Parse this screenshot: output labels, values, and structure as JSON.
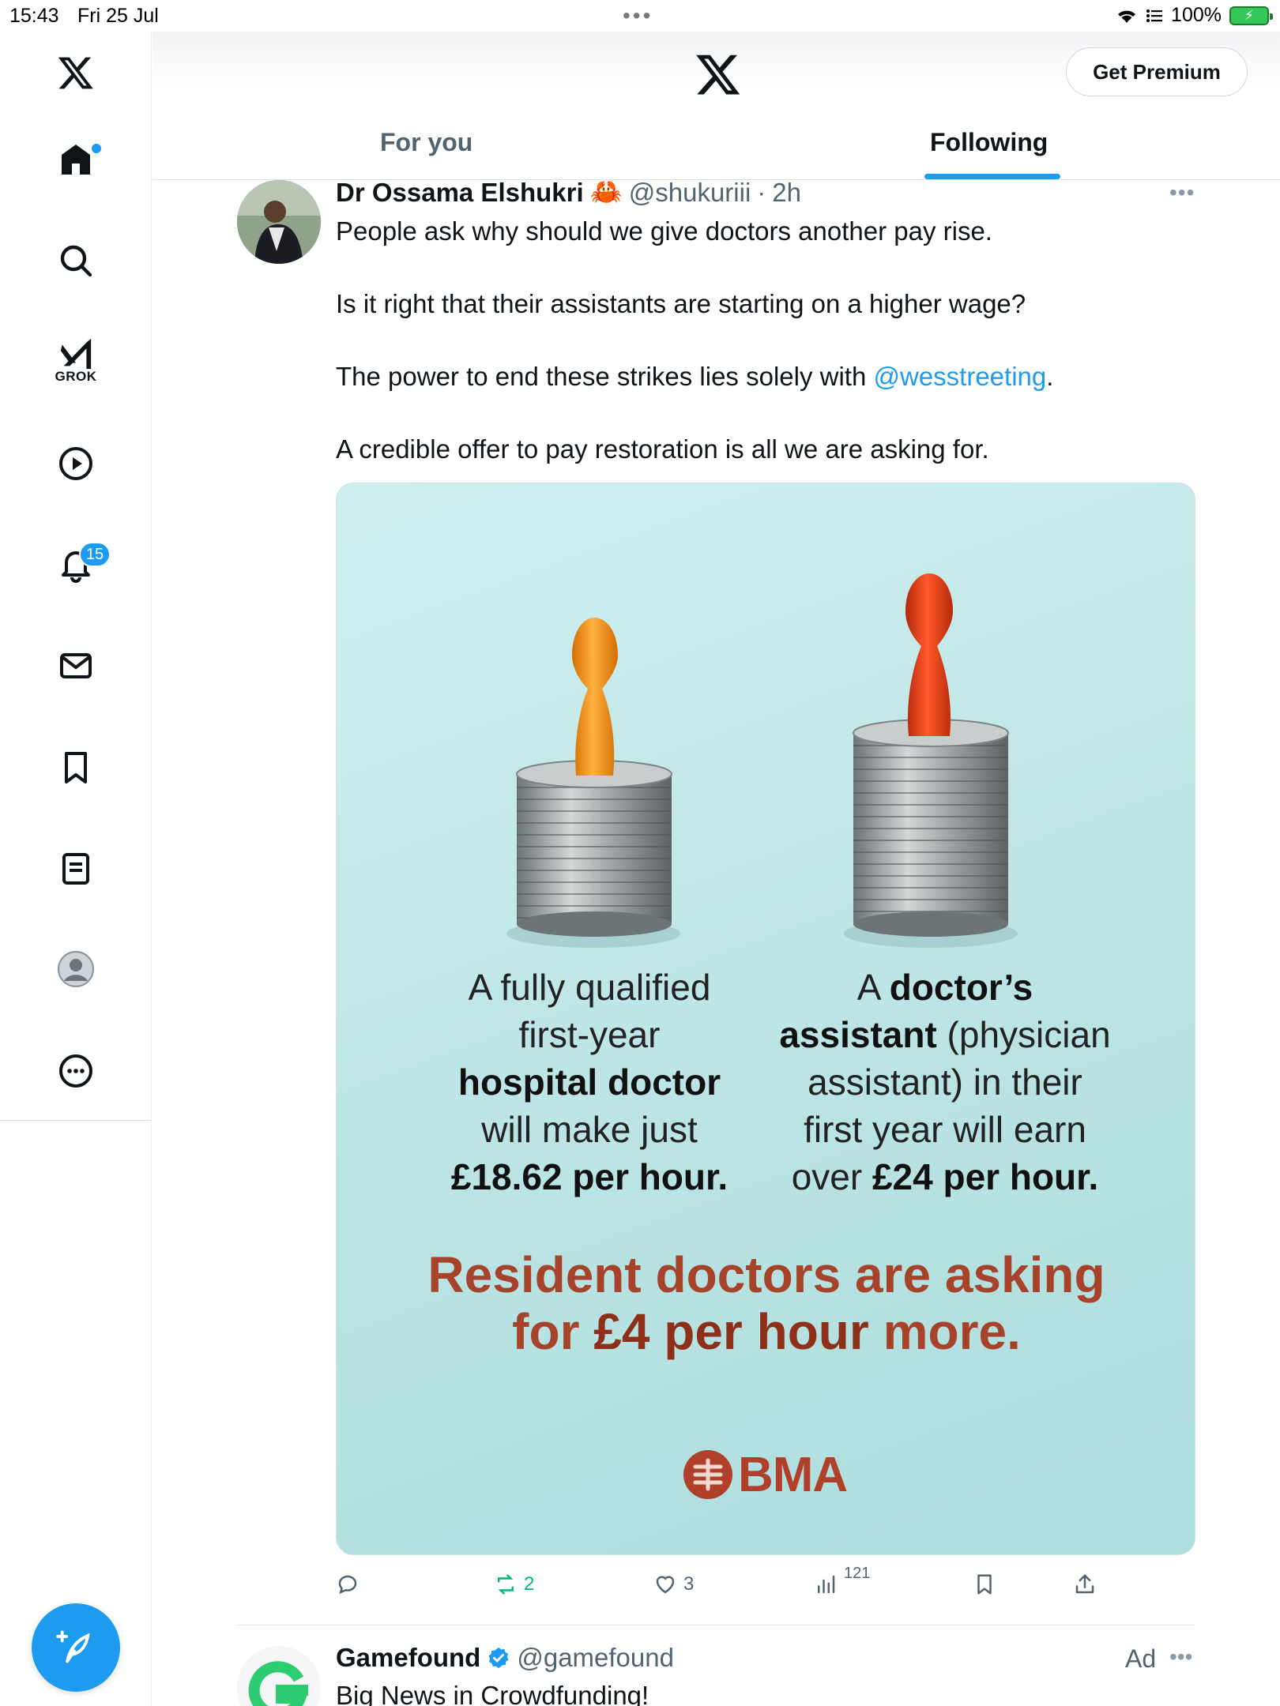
{
  "status_bar": {
    "time": "15:43",
    "date": "Fri 25 Jul",
    "battery": "100%"
  },
  "header": {
    "premium_label": "Get Premium",
    "tabs": [
      "For you",
      "Following"
    ],
    "active_tab": "Following"
  },
  "sidebar": {
    "items": [
      "home-icon",
      "search-icon",
      "grok-icon",
      "video-icon",
      "notifications-icon",
      "messages-icon",
      "bookmarks-icon",
      "lists-icon",
      "profile-icon",
      "more-icon"
    ],
    "grok_label": "GROK",
    "notification_count": "15"
  },
  "tweet": {
    "name": "Dr Ossama Elshukri",
    "emoji": "🦀",
    "handle": "@shukuriii",
    "sep": "·",
    "time": "2h",
    "lines": [
      "People ask why should we give doctors another pay rise.",
      "Is it right that their assistants are starting on a higher wage?",
      "The power to end these strikes lies solely with ",
      "A credible offer to pay restoration is all we are asking for."
    ],
    "mention": "@wesstreeting",
    "mention_suffix": ".",
    "image": {
      "left": {
        "l1": "A fully qualified",
        "l2": "first-year",
        "l3": "hospital doctor",
        "l4": "will make just",
        "l5": "£18.62 per hour."
      },
      "right": {
        "l1a": "A ",
        "l1b": "doctor’s",
        "l2a": "assistant",
        "l2b": " (physician",
        "l3": "assistant) in their",
        "l4": "first year will earn",
        "l5a": "over ",
        "l5b": "£24 per hour."
      },
      "headline": {
        "l1": "Resident doctors are asking",
        "l2a": "for ",
        "l2b": "£4 per hour",
        "l2c": " more."
      },
      "logo_text": "BMA"
    },
    "actions": {
      "retweets": "2",
      "likes": "3",
      "views": "121"
    }
  },
  "tweet2": {
    "name": "Gamefound",
    "handle": "@gamefound",
    "ad_label": "Ad",
    "text": "Big News in Crowdfunding!"
  },
  "colors": {
    "accent": "#1d9bf0",
    "retweet": "#00ba7c",
    "headline": "#a8432b",
    "pawn_orange": "#f39a1e",
    "pawn_red": "#e8441b"
  }
}
